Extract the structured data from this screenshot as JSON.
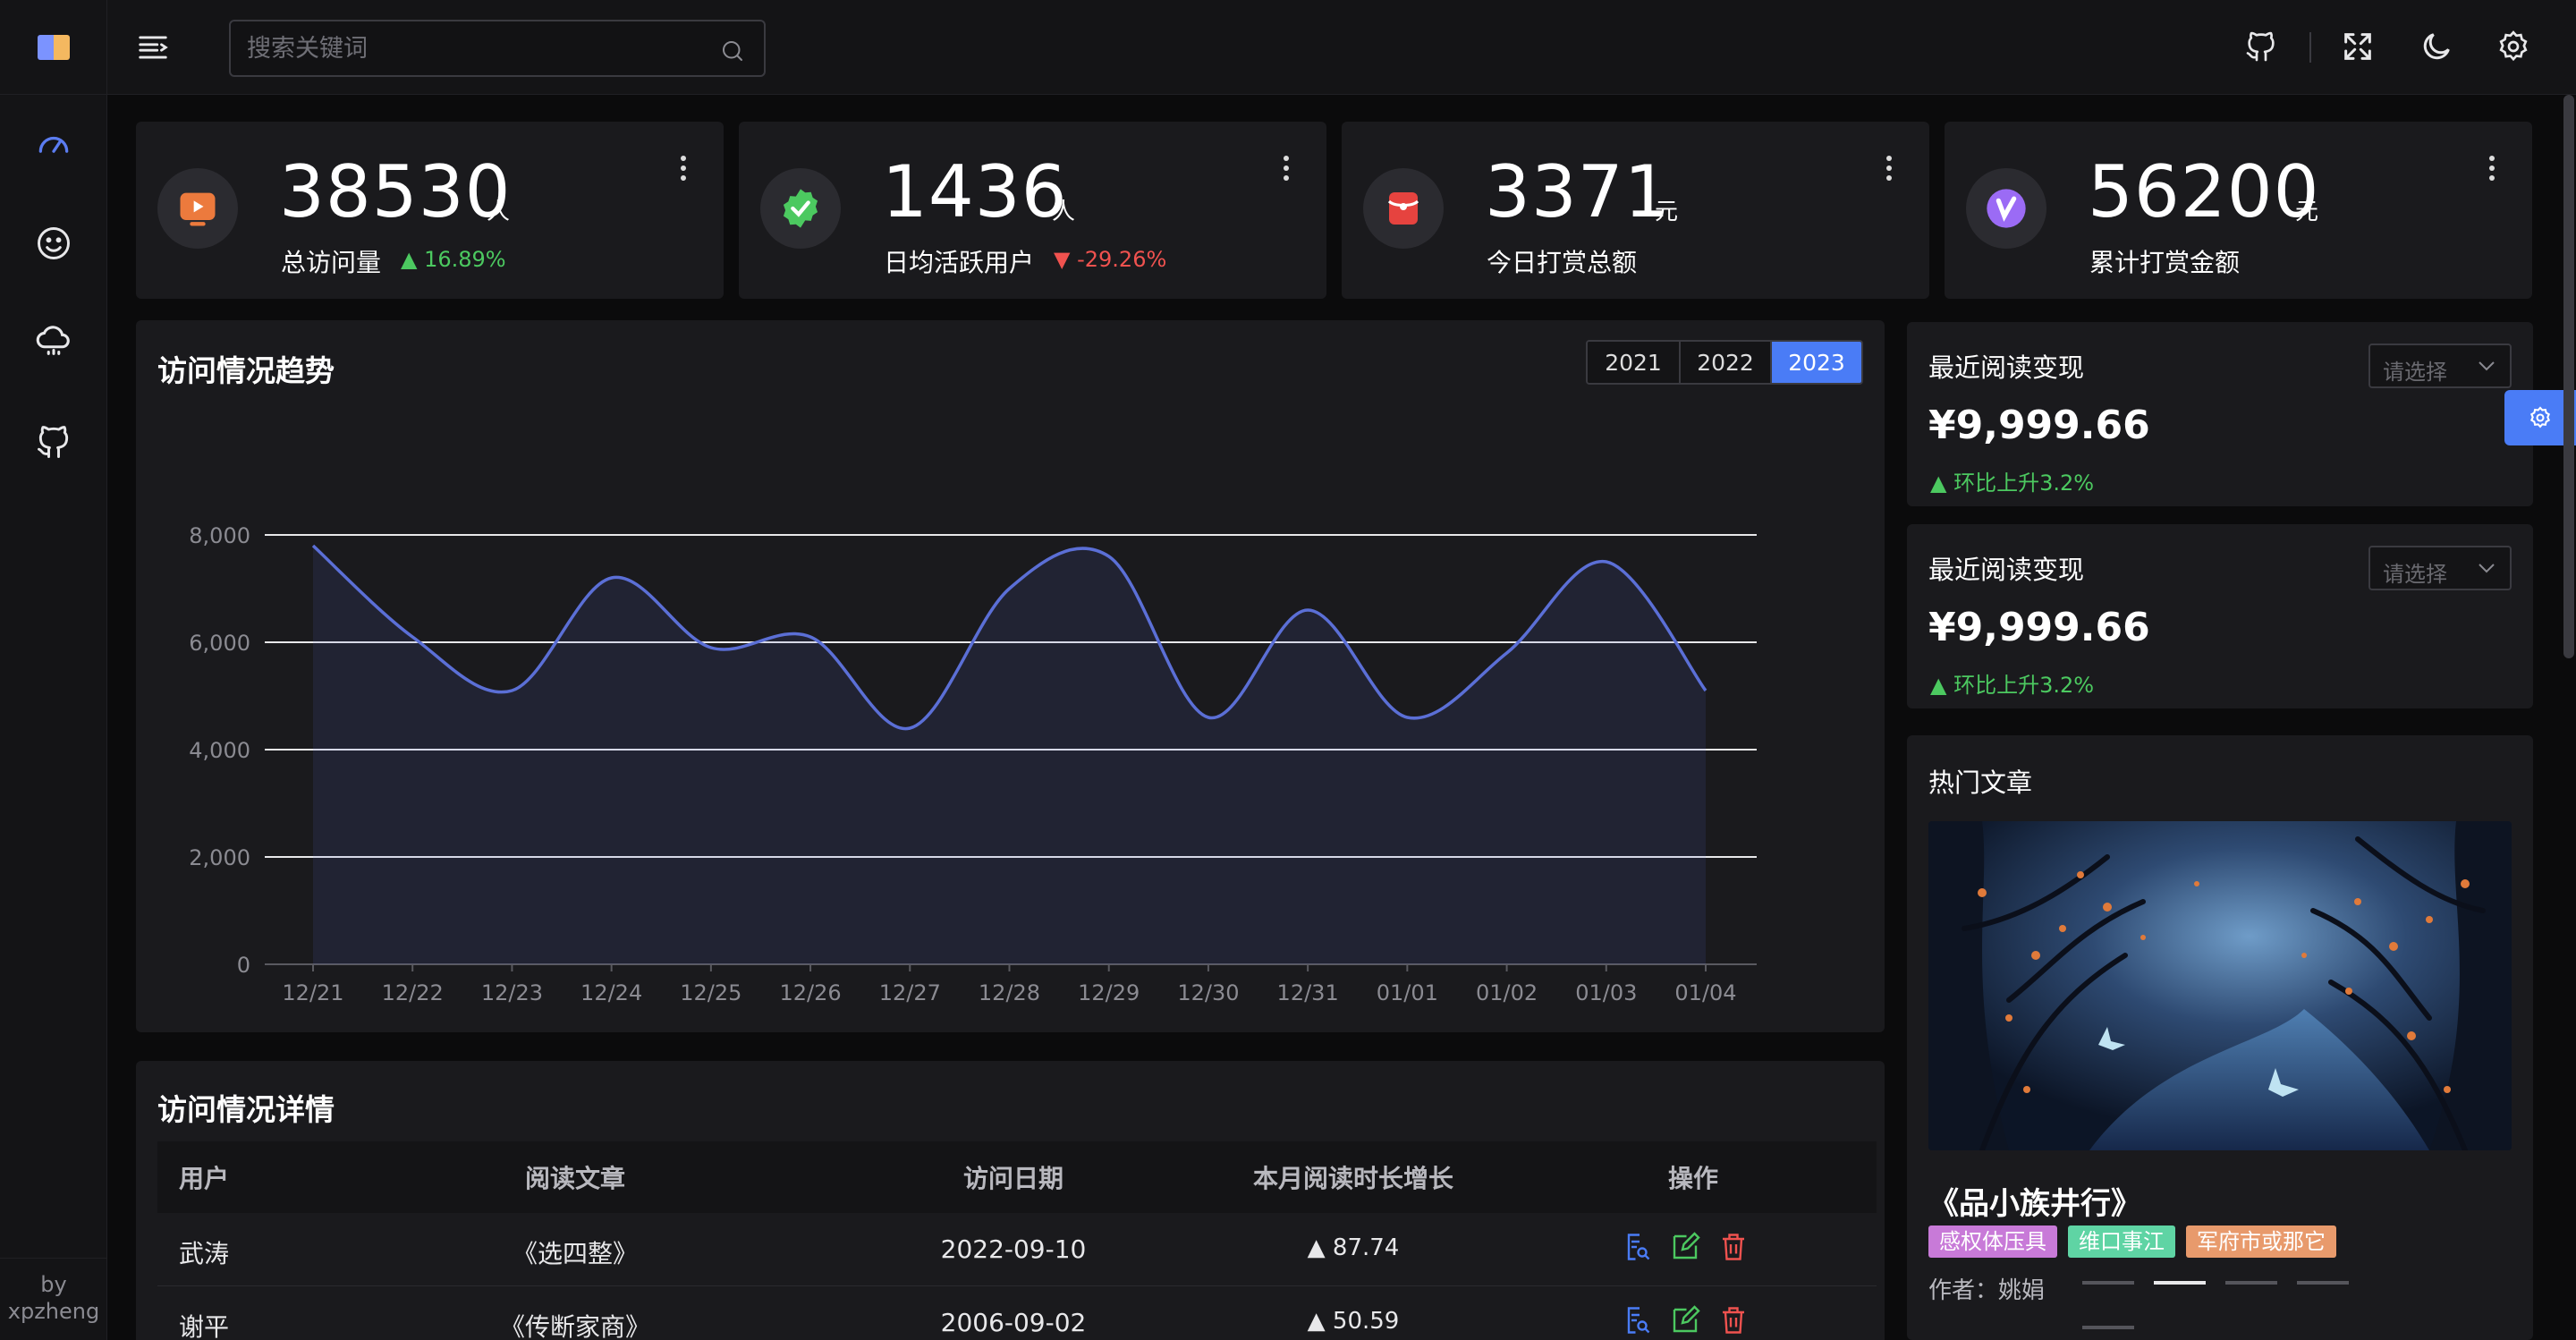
{
  "sidebar": {
    "footer_by": "by",
    "footer_author": "xpzheng"
  },
  "header": {
    "search_placeholder": "搜索关键词"
  },
  "stats": [
    {
      "value": "38530",
      "unit": "人",
      "label": "总访问量",
      "trend": "16.89%",
      "direction": "up",
      "icon": "video-icon",
      "color": "#e86b3a"
    },
    {
      "value": "1436",
      "unit": "人",
      "label": "日均活跃用户",
      "trend": "-29.26%",
      "direction": "down",
      "icon": "verified-badge-icon",
      "color": "#4cc960"
    },
    {
      "value": "3371",
      "unit": "元",
      "label": "今日打赏总额",
      "trend": "",
      "direction": "",
      "icon": "red-envelope-icon",
      "color": "#e6433f"
    },
    {
      "value": "56200",
      "unit": "元",
      "label": "累计打赏金额",
      "trend": "",
      "direction": "",
      "icon": "v-badge-icon",
      "color": "#9b6bf5"
    }
  ],
  "trend_card": {
    "title": "访问情况趋势",
    "years": [
      "2021",
      "2022",
      "2023"
    ],
    "active_year": "2023"
  },
  "chart_data": {
    "type": "area",
    "title": "访问情况趋势",
    "x": [
      "12/21",
      "12/22",
      "12/23",
      "12/24",
      "12/25",
      "12/26",
      "12/27",
      "12/28",
      "12/29",
      "12/30",
      "12/31",
      "01/01",
      "01/02",
      "01/03",
      "01/04"
    ],
    "values": [
      7800,
      6100,
      5100,
      7200,
      5900,
      6100,
      4400,
      7000,
      7600,
      4600,
      6600,
      4600,
      5800,
      7500,
      5100
    ],
    "y_ticks": [
      "0",
      "2,000",
      "4,000",
      "6,000",
      "8,000"
    ],
    "ylim": [
      0,
      8000
    ],
    "line_color": "#5b6fd6",
    "grid": true
  },
  "read_cards": [
    {
      "title": "最近阅读变现",
      "select_placeholder": "请选择",
      "amount": "¥9,999.66",
      "trend": "环比上升3.2%"
    },
    {
      "title": "最近阅读变现",
      "select_placeholder": "请选择",
      "amount": "¥9,999.66",
      "trend": "环比上升3.2%"
    }
  ],
  "hot": {
    "title": "热门文章",
    "article_title": "《品小族井行》",
    "tags": [
      {
        "label": "感权体压具",
        "color": "#c87ad8"
      },
      {
        "label": "维口事江",
        "color": "#5fd4a4"
      },
      {
        "label": "军府市或那它",
        "color": "#e89a6c"
      }
    ],
    "author": "作者：姚娟"
  },
  "table": {
    "title": "访问情况详情",
    "headers": [
      "用户",
      "阅读文章",
      "访问日期",
      "本月阅读时长增长",
      "操作"
    ],
    "rows": [
      {
        "user": "武涛",
        "article": "《选四整》",
        "date": "2022-09-10",
        "growth": "87.74"
      },
      {
        "user": "谢平",
        "article": "《传断家商》",
        "date": "2006-09-02",
        "growth": "50.59"
      }
    ]
  }
}
